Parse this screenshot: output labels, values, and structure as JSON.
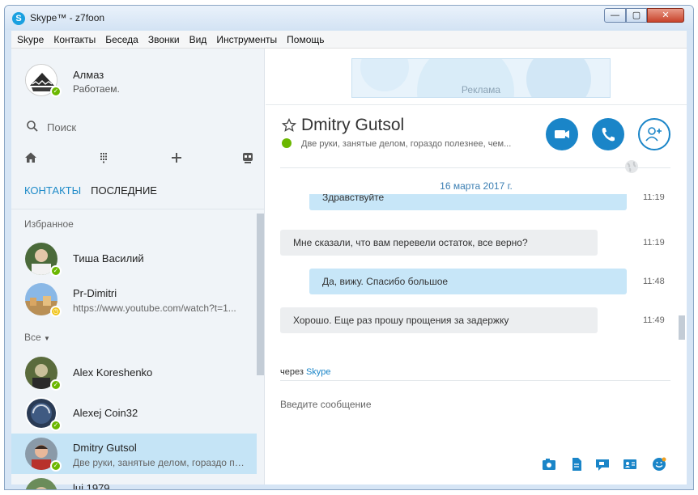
{
  "window": {
    "title": "Skype™ - z7foon",
    "app_icon_letter": "S",
    "min_glyph": "—",
    "max_glyph": "▢",
    "close_glyph": "✕"
  },
  "menu": [
    "Skype",
    "Контакты",
    "Беседа",
    "Звонки",
    "Вид",
    "Инструменты",
    "Помощь"
  ],
  "profile": {
    "name": "Алмаз",
    "mood": "Работаем.",
    "status": "online"
  },
  "search": {
    "placeholder": "Поиск"
  },
  "sidebar_toolbar": [
    "home-icon",
    "dialpad-icon",
    "add-icon",
    "bot-icon"
  ],
  "tabs": [
    {
      "label": "КОНТАКТЫ",
      "active": true
    },
    {
      "label": "ПОСЛЕДНИЕ",
      "active": false
    }
  ],
  "favorites_label": "Избранное",
  "all_label": "Все",
  "favorites": [
    {
      "name": "Тиша Василий",
      "mood": "",
      "status": "online"
    },
    {
      "name": "Pr-Dimitri",
      "mood": "https://www.youtube.com/watch?t=1...",
      "status": "away"
    }
  ],
  "contacts": [
    {
      "name": "Alex Koreshenko",
      "mood": "",
      "status": "online"
    },
    {
      "name": "Alexej Coin32",
      "mood": "",
      "status": "online"
    },
    {
      "name": "Dmitry Gutsol",
      "mood": "Две руки, занятые делом, гораздо по...",
      "status": "online",
      "selected": true
    },
    {
      "name": "lui 1979",
      "mood": "",
      "status": "online"
    }
  ],
  "ad": {
    "label": "Реклама"
  },
  "chat": {
    "name": "Dmitry Gutsol",
    "mood": "Две руки, занятые делом, гораздо полезнее, чем...",
    "date": "16 марта 2017 г.",
    "messages": [
      {
        "text": "Здравствуйте",
        "time": "11:19",
        "dir": "out"
      },
      {
        "text": "Мне сказали, что вам перевели остаток, все верно?",
        "time": "11:19",
        "dir": "in"
      },
      {
        "text": "Да, вижу. Спасибо большое",
        "time": "11:48",
        "dir": "out"
      },
      {
        "text": "Хорошо. Еще раз прошу прощения за задержку",
        "time": "11:49",
        "dir": "in"
      }
    ],
    "via_prefix": "через",
    "via_brand": "Skype",
    "compose_placeholder": "Введите сообщение"
  },
  "colors": {
    "accent": "#1a85c8",
    "online": "#6bb700",
    "away": "#f0c419",
    "selected": "#c5e4f6"
  }
}
